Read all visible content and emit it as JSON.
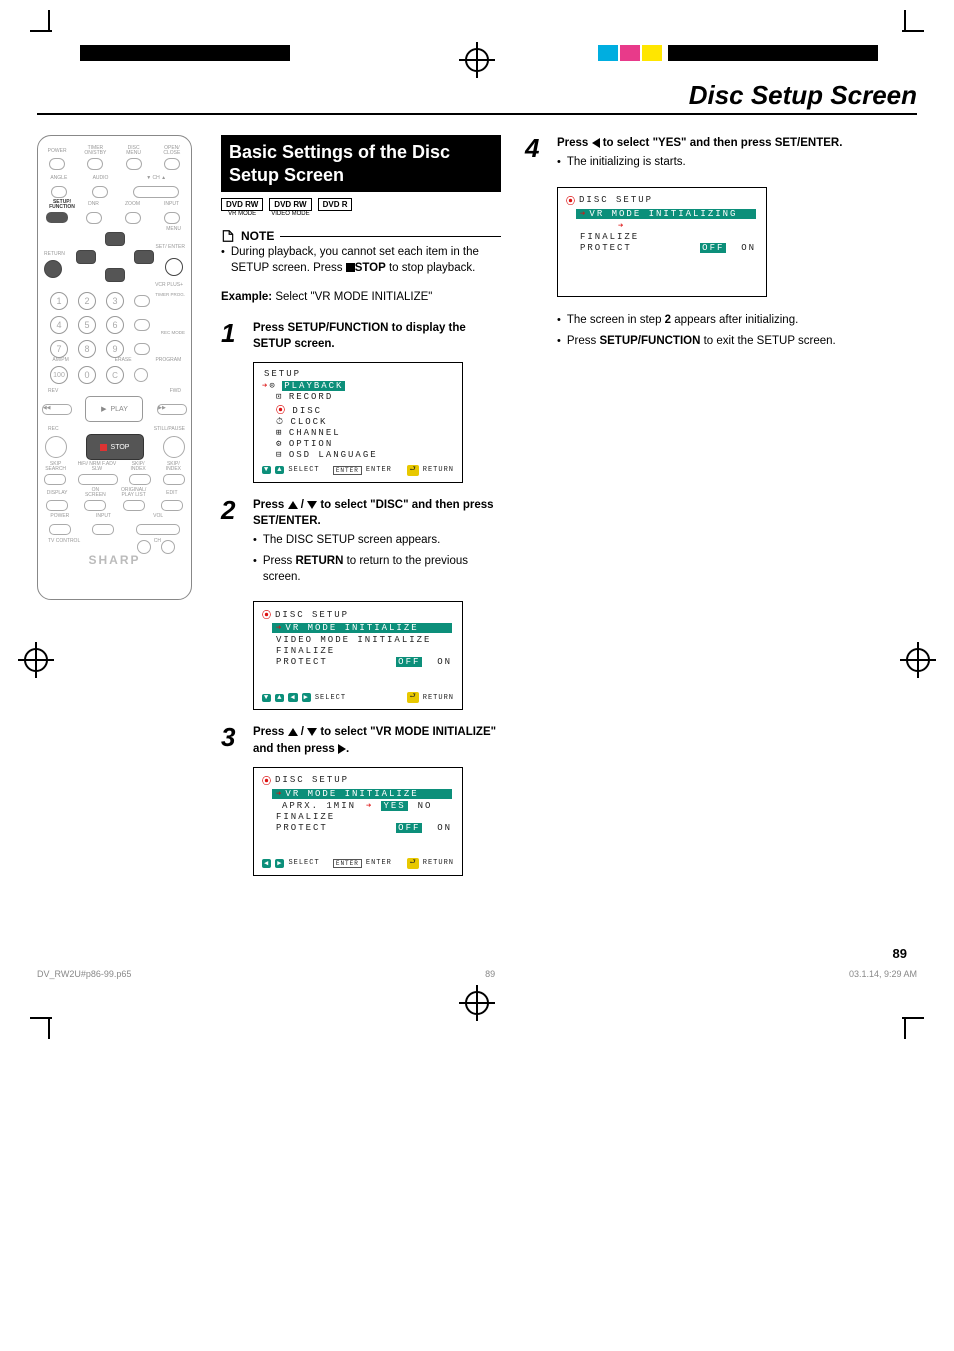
{
  "page": {
    "title": "Disc Setup Screen",
    "number": "89"
  },
  "footer": {
    "file": "DV_RW2U#p86-99.p65",
    "page": "89",
    "timestamp": "03.1.14, 9:29 AM"
  },
  "remote": {
    "brand": "SHARP",
    "row1": [
      "POWER",
      "TIMER ON/STBY",
      "DISC MENU",
      "OPEN/ CLOSE"
    ],
    "row2": [
      "ANGLE",
      "AUDIO",
      "▼ CH ▲"
    ],
    "setup_function": "SETUP/ FUNCTION",
    "row3": [
      "DNR",
      "ZOOM",
      "INPUT"
    ],
    "menu": "MENU",
    "return": "RETURN",
    "set_enter": "SET/ ENTER",
    "vcrplus": "VCR PLUS+",
    "timer_prog": "TIMER PROG.",
    "rec_mode": "REC MODE",
    "row_misc": [
      "AM/PM",
      "ERASE",
      "PROGRAM"
    ],
    "rev": "REV",
    "fwd": "FWD",
    "play": "PLAY",
    "rec": "REC",
    "stop": "STOP",
    "stillpause": "STILL/PAUSE",
    "rowA": [
      "SKIP SEARCH",
      "HiFi/ NRM",
      "F.ADV",
      "SLW",
      "SKIP/ INDEX",
      "SKIP/ INDEX"
    ],
    "rowB": [
      "DISPLAY",
      "ON SCREEN",
      "ORIGINAL/ PLAY LIST",
      "EDIT"
    ],
    "rowC": [
      "POWER",
      "INPUT",
      "VOL"
    ],
    "tvcontrol": "TV CONTROL",
    "ch": "CH"
  },
  "mid": {
    "header": "Basic Settings of the Disc Setup Screen",
    "badges": [
      {
        "top": "DVD RW",
        "sub": "VR MODE"
      },
      {
        "top": "DVD RW",
        "sub": "VIDEO MODE"
      },
      {
        "top": "DVD R",
        "sub": ""
      }
    ],
    "note_label": "NOTE",
    "note_text_a": "During playback, you cannot set each item in the SETUP screen. Press ",
    "note_stop": "STOP",
    "note_text_b": " to stop playback.",
    "example_label": "Example:",
    "example_text": " Select \"VR MODE INITIALIZE\"",
    "steps": {
      "s1": {
        "num": "1",
        "a": "Press ",
        "btn": "SETUP/FUNCTION",
        "b": " to display the SETUP screen."
      },
      "s2": {
        "num": "2",
        "a": "Press ",
        "mid": " / ",
        "b": " to select \"DISC\" and then press ",
        "btn": "SET/ENTER",
        "c": ".",
        "sub1": "The DISC SETUP screen appears.",
        "sub2a": "Press ",
        "sub2b": "RETURN",
        "sub2c": " to return to the previous screen."
      },
      "s3": {
        "num": "3",
        "a": "Press ",
        "mid": " / ",
        "b": " to select \"VR MODE INITIALIZE\" and then press ",
        "c": "."
      }
    },
    "osd1": {
      "title": "SETUP",
      "items": [
        "PLAYBACK",
        "RECORD",
        "DISC",
        "CLOCK",
        "CHANNEL",
        "OPTION",
        "OSD LANGUAGE"
      ],
      "foot_select": "SELECT",
      "foot_enter": "ENTER",
      "foot_return": "RETURN"
    },
    "osd2": {
      "title": "DISC SETUP",
      "hl": "VR MODE INITIALIZE",
      "r2": "VIDEO MODE INITIALIZE",
      "r3": "FINALIZE",
      "r4": "PROTECT",
      "off": "OFF",
      "on": "ON",
      "foot_select": "SELECT",
      "foot_return": "RETURN"
    },
    "osd3": {
      "title": "DISC SETUP",
      "hl": "VR MODE INITIALIZE",
      "aprx": "APRX. 1MIN",
      "yes": "YES",
      "no": "NO",
      "r3": "FINALIZE",
      "r4": "PROTECT",
      "off": "OFF",
      "on": "ON",
      "foot_select": "SELECT",
      "foot_enter": "ENTER",
      "foot_return": "RETURN"
    }
  },
  "right": {
    "s4": {
      "num": "4",
      "a": "Press ",
      "b": " to select \"YES\" and then press ",
      "btn": "SET/ENTER",
      "c": ".",
      "sub1": "The initializing is starts."
    },
    "osd4": {
      "title": "DISC SETUP",
      "hl": "VR MODE INITIALIZING",
      "r3": "FINALIZE",
      "r4": "PROTECT",
      "off": "OFF",
      "on": "ON"
    },
    "after1a": "The screen in step ",
    "after1b": "2",
    "after1c": " appears after initializing.",
    "after2a": "Press ",
    "after2b": "SETUP/FUNCTION",
    "after2c": " to exit the SETUP screen."
  }
}
